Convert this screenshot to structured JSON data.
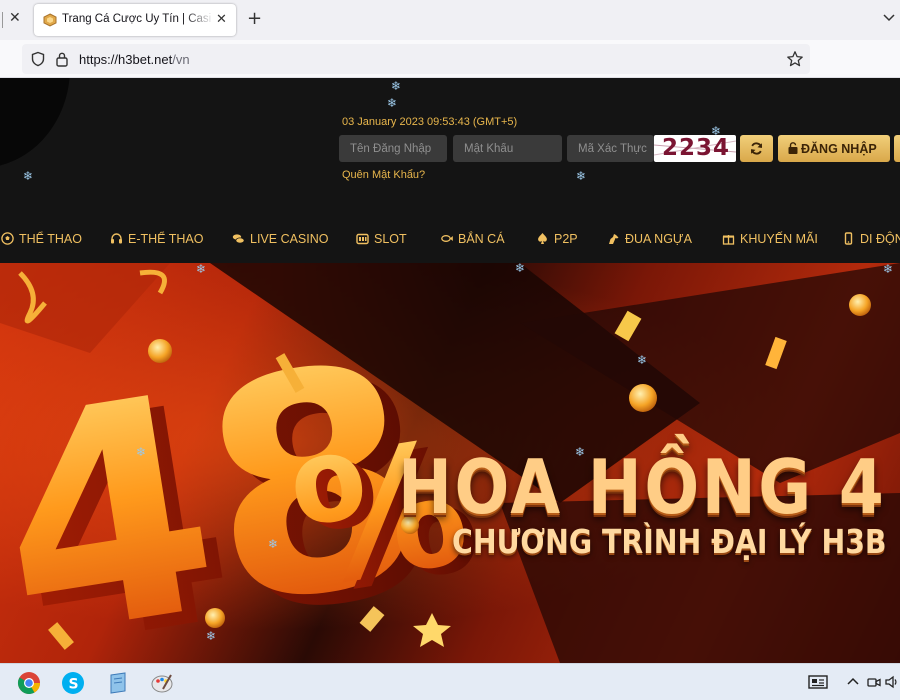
{
  "browser": {
    "tab_title": "Trang Cá Cược Uy Tín | Casino O",
    "url_host": "https://h3bet.net",
    "url_path": "/vn",
    "edge_close": "✕",
    "tab_close": "✕",
    "new_tab": "+"
  },
  "header": {
    "datetime": "03 January 2023 09:53:43 (GMT+5)",
    "username_placeholder": "Tên Đăng Nhập",
    "password_placeholder": "Mật Khẩu",
    "captcha_placeholder": "Mã Xác Thực",
    "captcha_code": "2234",
    "login_label": "ĐĂNG NHẬP",
    "forgot_password": "Quên Mật Khẩu?"
  },
  "menu": [
    {
      "label": "THỂ THAO",
      "icon": "soccer-ball-icon"
    },
    {
      "label": "E-THỂ THAO",
      "icon": "headset-icon"
    },
    {
      "label": "LIVE CASINO",
      "icon": "chips-icon"
    },
    {
      "label": "SLOT",
      "icon": "slot-machine-icon"
    },
    {
      "label": "BẮN CÁ",
      "icon": "fish-icon"
    },
    {
      "label": "P2P",
      "icon": "spade-icon"
    },
    {
      "label": "ĐUA NGỰA",
      "icon": "horse-icon"
    },
    {
      "label": "KHUYẾN MÃI",
      "icon": "gift-icon"
    },
    {
      "label": "DI ĐỘNG",
      "icon": "mobile-icon"
    }
  ],
  "banner": {
    "big_number": "48",
    "percent_sign": "%",
    "headline": "HOA HỒNG 4",
    "subheadline": "CHƯƠNG TRÌNH ĐẠI LÝ H3B"
  },
  "snowflake": "❄",
  "taskbar": {
    "apps": [
      "chrome-icon",
      "skype-icon",
      "notepad-icon",
      "paint-icon"
    ],
    "tray": [
      "news-icon",
      "chevron-up-icon",
      "meet-icon",
      "speaker-icon"
    ]
  },
  "colors": {
    "gold": "#f0c061",
    "header_bg": "#141414",
    "banner_red": "#c22d0c"
  }
}
